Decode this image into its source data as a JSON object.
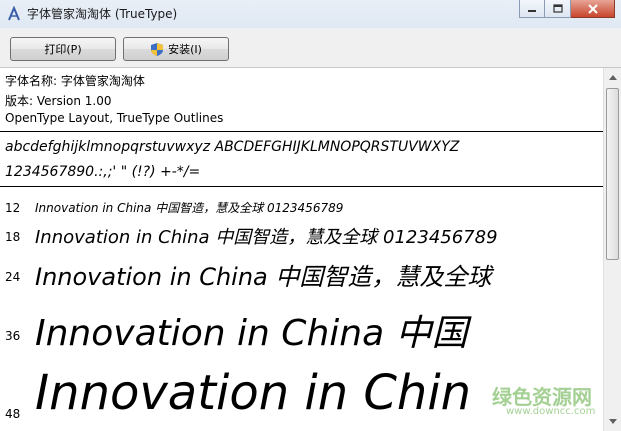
{
  "window": {
    "title": "字体管家淘淘体 (TrueType)",
    "minimize_icon": "minimize-icon",
    "maximize_icon": "maximize-icon",
    "close_icon": "close-icon"
  },
  "toolbar": {
    "print_label": "打印(P)",
    "install_label": "安装(I)",
    "install_icon": "shield-icon"
  },
  "font_info": {
    "name_line": "字体名称: 字体管家淘淘体",
    "version_line": "版本: Version 1.00",
    "type_line": "OpenType Layout, TrueType Outlines"
  },
  "charset": {
    "line1": "abcdefghijklmnopqrstuvwxyz ABCDEFGHIJKLMNOPQRSTUVWXYZ",
    "line2": "1234567890.:,;' \" (!?) +-*/="
  },
  "samples": [
    {
      "size": "12",
      "text": "Innovation in China 中国智造，慧及全球 0123456789"
    },
    {
      "size": "18",
      "text": "Innovation in China 中国智造，慧及全球 0123456789"
    },
    {
      "size": "24",
      "text": "Innovation in China 中国智造，慧及全球"
    },
    {
      "size": "36",
      "text": "Innovation in China 中国"
    },
    {
      "size": "48",
      "text": "Innovation in Chin"
    }
  ],
  "watermark": {
    "text": "绿色资源网",
    "url": "www.downcc.com"
  }
}
